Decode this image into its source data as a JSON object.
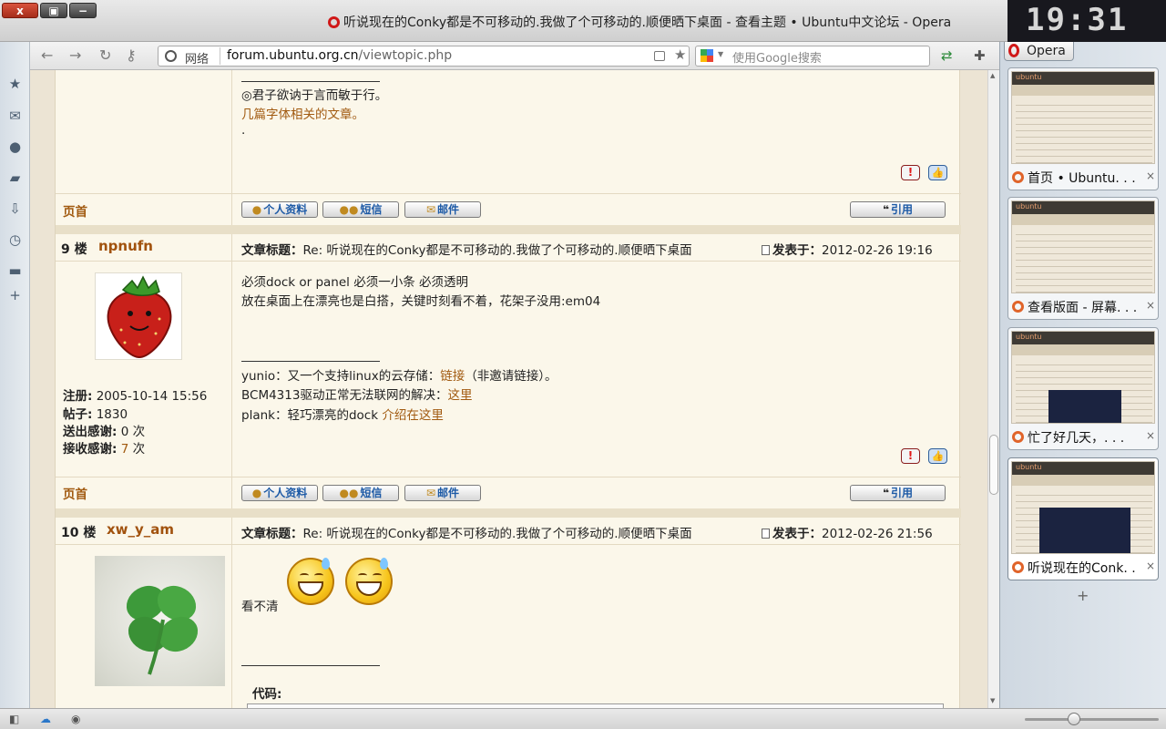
{
  "window": {
    "title": "听说现在的Conky都是不可移动的.我做了个可移动的.顺便晒下桌面 - 查看主题 • Ubuntu中文论坛 - Opera",
    "close": "x",
    "clock": "19:31"
  },
  "addressbar": {
    "security_label": "网络",
    "url_domain": "forum.ubuntu.org.cn",
    "url_path": "/viewtopic.php",
    "search_placeholder": "使用Google搜索"
  },
  "colors": {
    "link": "#a15a10",
    "author": "#a1520e",
    "button_text": "#1d5aa6",
    "forum_bg": "#fbf7ea",
    "opera_red": "#d01818"
  },
  "prev_post": {
    "sig_line1": "◎君子欲讷于言而敏于行。",
    "sig_link": "几篇字体相关的文章。",
    "sig_dot": ".",
    "top_link": "页首",
    "btn_profile": "个人资料",
    "btn_pm": "短信",
    "btn_email": "邮件",
    "btn_quote": "引用"
  },
  "posts": [
    {
      "floor": "9 楼",
      "author": "npnufn",
      "subject_label": "文章标题：",
      "subject": "Re: 听说现在的Conky都是不可移动的.我做了个可移动的.顺便晒下桌面",
      "posted_label": "发表于：",
      "posted": "2012-02-26 19:16",
      "body_line1": "必须dock or panel 必须一小条 必须透明",
      "body_line2": "放在桌面上在漂亮也是白搭，关键时刻看不着，花架子没用:em04",
      "sig1_prefix": "yunio：又一个支持linux的云存储：",
      "sig1_link": "链接",
      "sig1_suffix": "（非邀请链接）。",
      "sig2_prefix": "BCM4313驱动正常无法联网的解决：",
      "sig2_link": "这里",
      "sig3_prefix": "plank：轻巧漂亮的dock ",
      "sig3_link": "介绍在这里",
      "reg_label": "注册:",
      "reg_value": "2005-10-14 15:56",
      "posts_label": "帖子:",
      "posts_value": "1830",
      "thanks_given_label": "送出感谢:",
      "thanks_given_value": "0",
      "thanks_recv_label": "接收感谢:",
      "thanks_recv_value": "7",
      "times": "次",
      "top_link": "页首",
      "btn_profile": "个人资料",
      "btn_pm": "短信",
      "btn_email": "邮件",
      "btn_quote": "引用"
    },
    {
      "floor": "10 楼",
      "author": "xw_y_am",
      "subject_label": "文章标题：",
      "subject": "Re: 听说现在的Conky都是不可移动的.我做了个可移动的.顺便晒下桌面",
      "posted_label": "发表于：",
      "posted": "2012-02-26 21:56",
      "body_line1": "看不清",
      "code_label": "代码:"
    }
  ],
  "sidepanel": {
    "opera_label": "Opera",
    "tabs": [
      {
        "title": "首页 • Ubuntu. . .",
        "preview_logo": "ubuntu"
      },
      {
        "title": "查看版面 - 屏幕. . .",
        "preview_logo": "ubuntu"
      },
      {
        "title": "忙了好几天，. . .",
        "preview_logo": "ubuntu"
      },
      {
        "title": "听说现在的Conk. . .",
        "preview_logo": "ubuntu"
      }
    ],
    "close_glyph": "×",
    "new_tab": "+"
  }
}
